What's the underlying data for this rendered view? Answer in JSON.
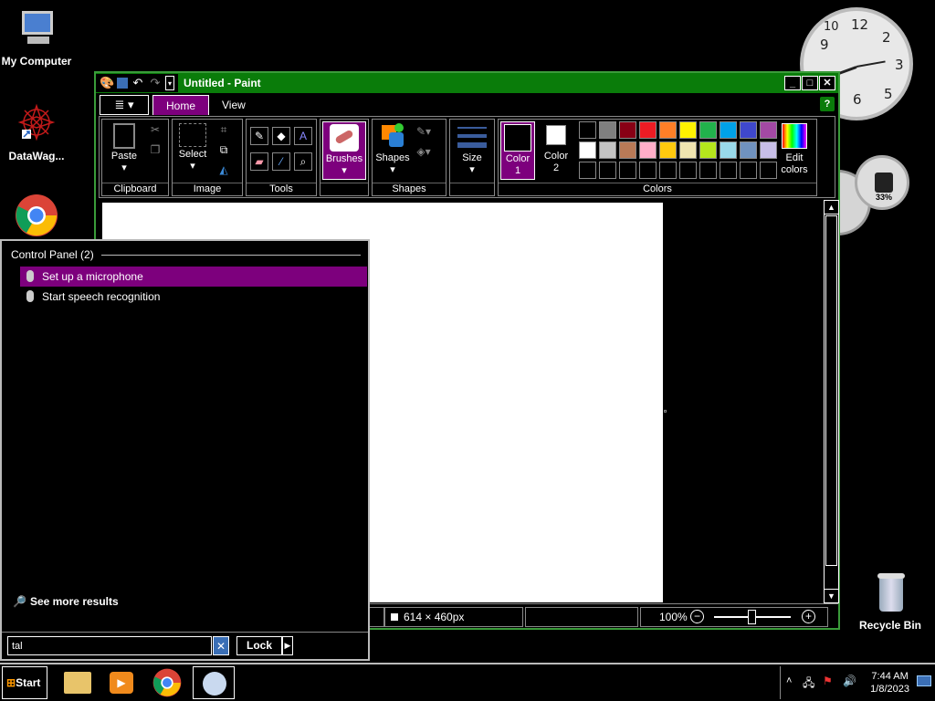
{
  "desktop": {
    "icons": [
      {
        "label": "My Computer"
      },
      {
        "label": "DataWag..."
      },
      {
        "label": ""
      },
      {
        "label": "Recycle Bin"
      }
    ],
    "gauge_percent": "33%"
  },
  "paint": {
    "title": "Untitled - Paint",
    "tabs": [
      "Home",
      "View"
    ],
    "groups": {
      "clipboard": "Clipboard",
      "image": "Image",
      "tools": "Tools",
      "shapes": "Shapes",
      "colors": "Colors"
    },
    "buttons": {
      "paste": "Paste",
      "select": "Select",
      "brushes": "Brushes",
      "shapes": "Shapes",
      "size": "Size",
      "color1": "Color\n1",
      "color1_a": "Color",
      "color1_b": "1",
      "color2_a": "Color",
      "color2_b": "2",
      "edit_a": "Edit",
      "edit_b": "colors"
    },
    "palette_row1": [
      "#000000",
      "#7f7f7f",
      "#880015",
      "#ed1c24",
      "#ff7f27",
      "#fff200",
      "#22b14c",
      "#00a2e8",
      "#3f48cc",
      "#a349a4"
    ],
    "palette_row2": [
      "#ffffff",
      "#c3c3c3",
      "#b97a57",
      "#ffaec9",
      "#ffc90e",
      "#efe4b0",
      "#b5e61d",
      "#99d9ea",
      "#7092be",
      "#c8bfe7"
    ],
    "status": {
      "size": "614 × 460px",
      "zoom": "100%"
    }
  },
  "startmenu": {
    "header": "Control Panel (2)",
    "items": [
      "Set up a microphone",
      "Start speech recognition"
    ],
    "see_more": "See more results",
    "search_value": "tal",
    "lock_label": "Lock"
  },
  "taskbar": {
    "start_label": "Start",
    "time": "7:44 AM",
    "date": "1/8/2023"
  }
}
